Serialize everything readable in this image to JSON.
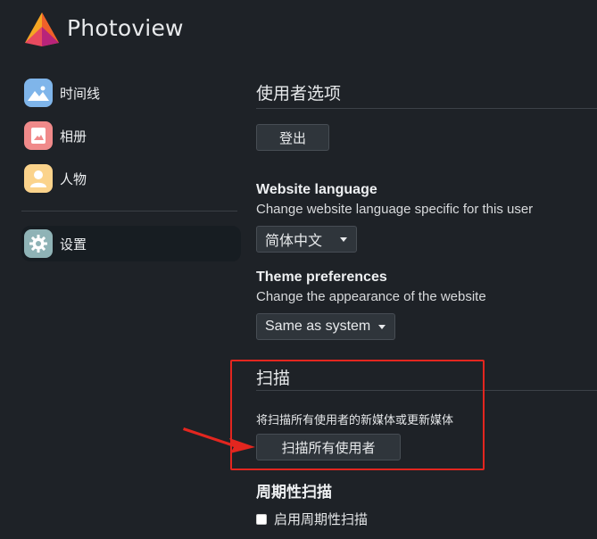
{
  "app": {
    "title": "Photoview"
  },
  "sidebar": {
    "items": [
      {
        "label": "时间线",
        "icon": "timeline-icon",
        "color": "#7fb5ea"
      },
      {
        "label": "相册",
        "icon": "album-icon",
        "color": "#f08a8a"
      },
      {
        "label": "人物",
        "icon": "person-icon",
        "color": "#fbd38b"
      },
      {
        "label": "设置",
        "icon": "gear-icon",
        "color": "#8fb3b6",
        "active": true
      }
    ]
  },
  "user_prefs": {
    "title": "使用者选项",
    "logout_label": "登出",
    "language": {
      "title": "Website language",
      "description": "Change website language specific for this user",
      "selected": "简体中文"
    },
    "theme": {
      "title": "Theme preferences",
      "description": "Change the appearance of the website",
      "selected": "Same as system"
    }
  },
  "scanner": {
    "title": "扫描",
    "description": "将扫描所有使用者的新媒体或更新媒体",
    "scan_all_label": "扫描所有使用者"
  },
  "periodic_scan": {
    "title": "周期性扫描",
    "enable_label": "启用周期性扫描",
    "checked": false
  },
  "annotation": {
    "highlight_color": "#e3261f"
  }
}
